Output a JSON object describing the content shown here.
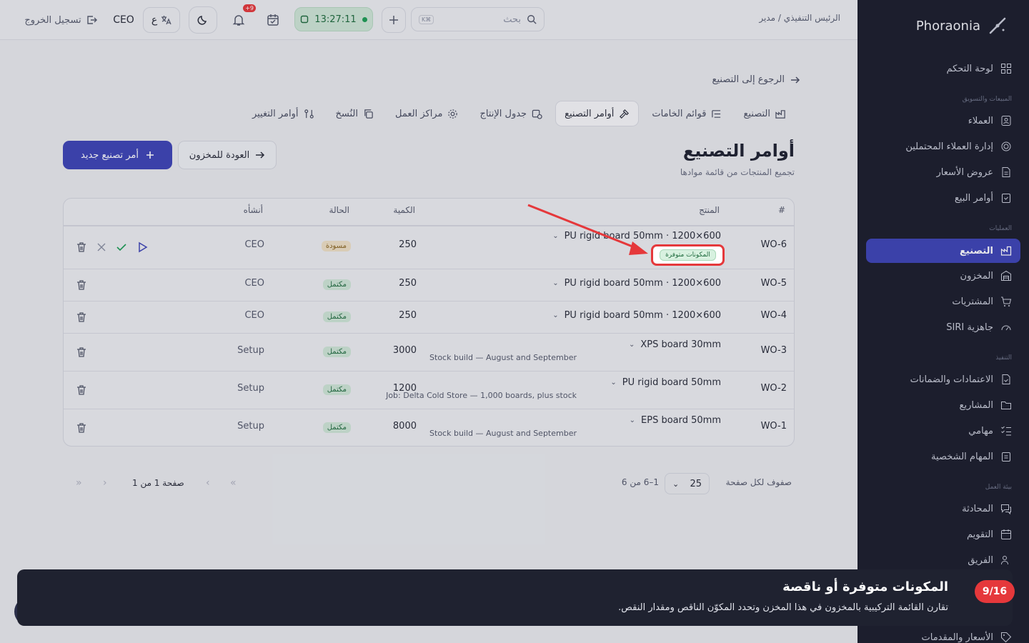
{
  "app": {
    "brand": "Phoraonia"
  },
  "topbar": {
    "breadcrumb": "الرئيس التنفيذي / مدير",
    "search_placeholder": "بحث",
    "search_kbd": "K⌘",
    "timer": "13:27:11",
    "notif_count": "+9",
    "lang": "ع",
    "user": "CEO",
    "logout": "تسجيل الخروج"
  },
  "sidebar": {
    "sections": {
      "sales": "المبيعات والتسويق",
      "ops": "العمليات",
      "exec": "التنفيذ",
      "work": "بيئة العمل"
    },
    "items": [
      {
        "label": "لوحة التحكم",
        "icon": "dashboard-icon"
      },
      {
        "label": "العملاء",
        "icon": "contacts-icon"
      },
      {
        "label": "إدارة العملاء المحتملين",
        "icon": "target-icon"
      },
      {
        "label": "عروض الأسعار",
        "icon": "document-icon"
      },
      {
        "label": "أوامر البيع",
        "icon": "clipboard-icon"
      },
      {
        "label": "التصنيع",
        "icon": "factory-icon"
      },
      {
        "label": "المخزون",
        "icon": "warehouse-icon"
      },
      {
        "label": "المشتريات",
        "icon": "cart-icon"
      },
      {
        "label": "جاهزية SIRI",
        "icon": "gauge-icon"
      },
      {
        "label": "الاعتمادات والضمانات",
        "icon": "file-check-icon"
      },
      {
        "label": "المشاريع",
        "icon": "folder-icon"
      },
      {
        "label": "مهامي",
        "icon": "checklist-icon"
      },
      {
        "label": "المهام الشخصية",
        "icon": "clipboard-icon"
      },
      {
        "label": "المحادثة",
        "icon": "chat-icon"
      },
      {
        "label": "التقويم",
        "icon": "calendar-icon"
      },
      {
        "label": "الفريق",
        "icon": "users-icon"
      },
      {
        "label": "الأسعار والمقدمات",
        "icon": "tag-icon"
      }
    ]
  },
  "content": {
    "back_link": "الرجوع إلى التصنيع",
    "tabs": [
      "التصنيع",
      "قوائم الخامات",
      "أوامر التصنيع",
      "جدول الإنتاج",
      "مراكز العمل",
      "النُسخ",
      "أوامر التغيير"
    ],
    "title": "أوامر التصنيع",
    "subtitle": "تجميع المنتجات من قائمة موادها",
    "new_order": "أمر تصنيع جديد",
    "back_inventory": "العودة للمخزون"
  },
  "table": {
    "headers": {
      "num": "#",
      "product": "المنتج",
      "qty": "الكمية",
      "status": "الحالة",
      "creator": "أنشأه"
    },
    "rows": [
      {
        "id": "WO-6",
        "product": "PU rigid board 50mm · 1200×600",
        "note": "",
        "qty": "250",
        "status": "مسودة",
        "creator": "CEO"
      },
      {
        "id": "WO-5",
        "product": "PU rigid board 50mm · 1200×600",
        "note": "",
        "qty": "250",
        "status": "مكتمل",
        "creator": "CEO"
      },
      {
        "id": "WO-4",
        "product": "PU rigid board 50mm · 1200×600",
        "note": "",
        "qty": "250",
        "status": "مكتمل",
        "creator": "CEO"
      },
      {
        "id": "WO-3",
        "product": "XPS board 30mm",
        "note": "Stock build — August and September",
        "qty": "3000",
        "status": "مكتمل",
        "creator": "Setup"
      },
      {
        "id": "WO-2",
        "product": "PU rigid board 50mm",
        "note": "Job: Delta Cold Store — 1,000 boards, plus stock",
        "qty": "1200",
        "status": "مكتمل",
        "creator": "Setup"
      },
      {
        "id": "WO-1",
        "product": "EPS board 50mm",
        "note": "Stock build — August and September",
        "qty": "8000",
        "status": "مكتمل",
        "creator": "Setup"
      }
    ],
    "availability_tag": "المكونات متوفرة"
  },
  "pagination": {
    "rows_label": "صفوف لكل صفحة",
    "page_size": "25",
    "range": "1–6 من 6",
    "page": "صفحة 1 من 1"
  },
  "tour": {
    "step": "9/16",
    "title": "المكونات متوفرة أو ناقصة",
    "text": "تقارن القائمة التركيبية بالمخزون في هذا المخزن وتحدد المكوّن الناقص ومقدار النقص."
  },
  "colors": {
    "accent": "#3e44b6",
    "sidebar": "#1b1e2c",
    "highlight": "#e5383b",
    "success": "#1f6b3e"
  }
}
